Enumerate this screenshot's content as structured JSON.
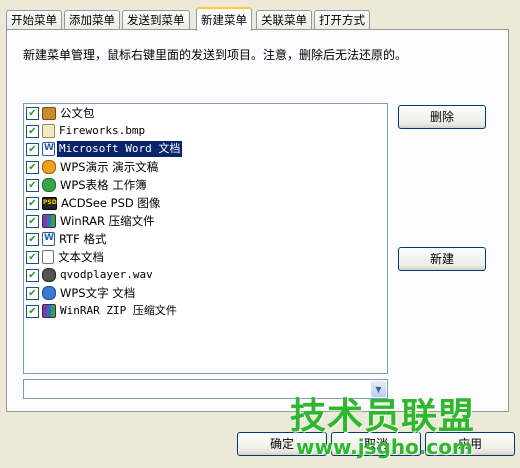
{
  "tabs": [
    {
      "label": "开始菜单"
    },
    {
      "label": "添加菜单"
    },
    {
      "label": "发送到菜单"
    },
    {
      "label": "新建菜单"
    },
    {
      "label": "关联菜单"
    },
    {
      "label": "打开方式"
    }
  ],
  "description": "新建菜单管理，鼠标右键里面的发送到项目。注意，删除后无法还原的。",
  "items": [
    {
      "label": "公文包",
      "icon": "briefcase-icon",
      "checked": true
    },
    {
      "label": "Fireworks.bmp",
      "icon": "image-file-icon",
      "checked": true
    },
    {
      "label": "Microsoft Word 文档",
      "icon": "word-document-icon",
      "checked": true,
      "selected": true
    },
    {
      "label": "WPS演示 演示文稿",
      "icon": "wps-presentation-icon",
      "checked": true
    },
    {
      "label": "WPS表格 工作簿",
      "icon": "wps-spreadsheet-icon",
      "checked": true
    },
    {
      "label": "ACDSee PSD 图像",
      "icon": "psd-image-icon",
      "checked": true
    },
    {
      "label": "WinRAR 压缩文件",
      "icon": "winrar-archive-icon",
      "checked": true
    },
    {
      "label": "RTF 格式",
      "icon": "rtf-document-icon",
      "checked": true
    },
    {
      "label": "文本文档",
      "icon": "text-document-icon",
      "checked": true
    },
    {
      "label": "qvodplayer.wav",
      "icon": "audio-file-icon",
      "checked": true
    },
    {
      "label": "WPS文字 文档",
      "icon": "wps-writer-icon",
      "checked": true
    },
    {
      "label": "WinRAR ZIP 压缩文件",
      "icon": "zip-archive-icon",
      "checked": true
    }
  ],
  "buttons": {
    "delete": "删除",
    "new": "新建",
    "ok": "确定",
    "cancel": "取消",
    "apply": "应用"
  },
  "combo": {
    "value": ""
  },
  "watermark": {
    "title": "技术员联盟",
    "url": "www.jsgho.com"
  },
  "colors": {
    "selection": "#0a246a",
    "active_tab_accent": "#ffc73c",
    "watermark": "#2eb82e"
  }
}
